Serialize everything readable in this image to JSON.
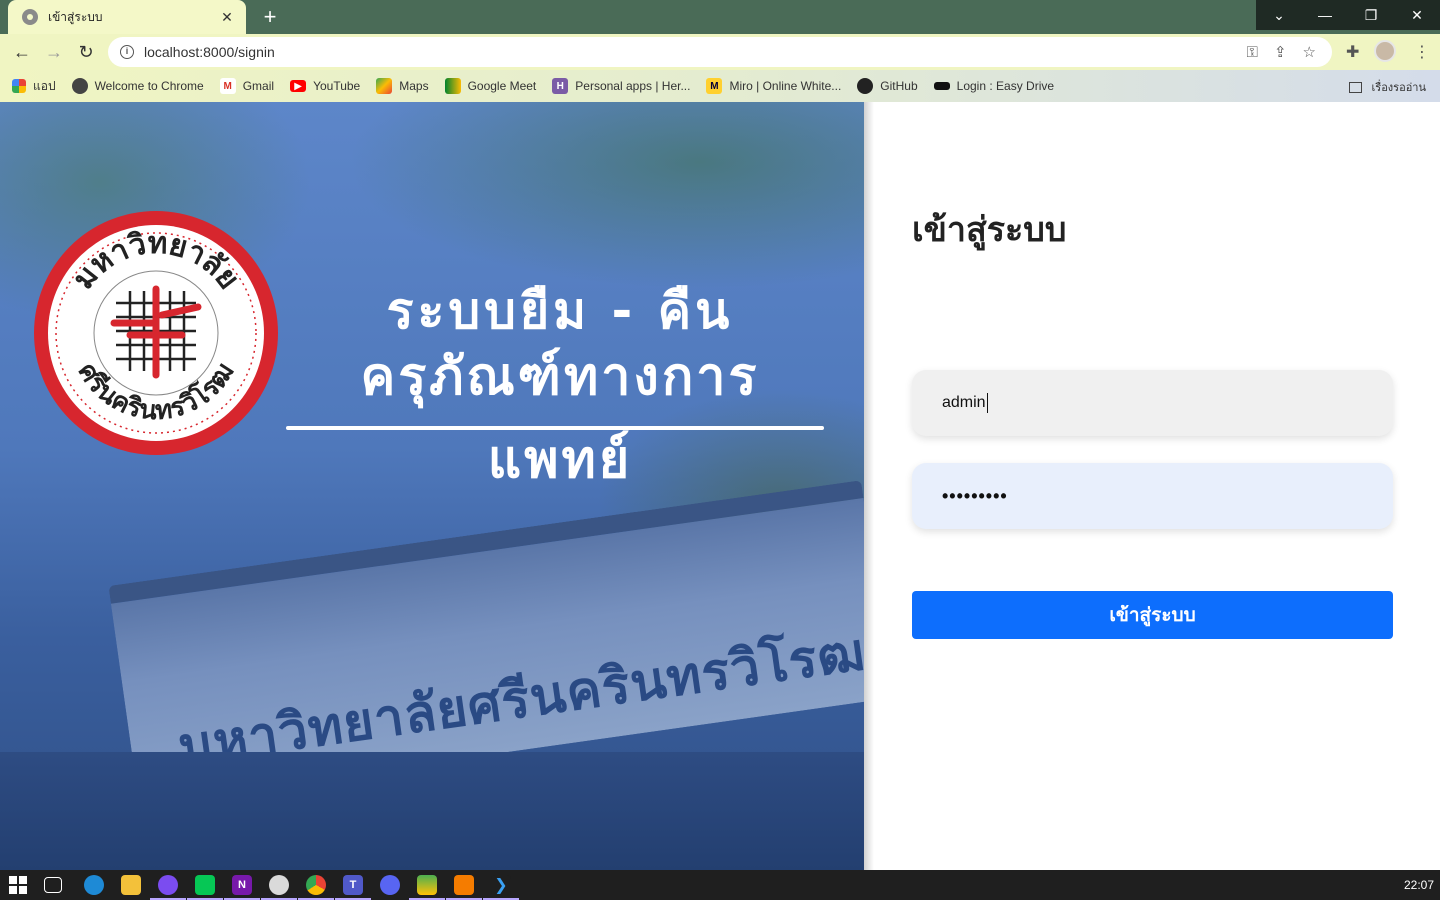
{
  "browser": {
    "tab_title": "เข้าสู่ระบบ",
    "tab_close": "✕",
    "new_tab": "+",
    "url": "localhost:8000/signin",
    "window_controls": [
      "⌄",
      "—",
      "❐",
      "✕"
    ],
    "bookmarks": [
      {
        "label": "แอป",
        "icon": "apps-grid-icon"
      },
      {
        "label": "Welcome to Chrome",
        "icon": "chrome-icon"
      },
      {
        "label": "Gmail",
        "icon": "gmail-icon"
      },
      {
        "label": "YouTube",
        "icon": "youtube-icon"
      },
      {
        "label": "Maps",
        "icon": "maps-icon"
      },
      {
        "label": "Google Meet",
        "icon": "meet-icon"
      },
      {
        "label": "Personal apps | Her...",
        "icon": "heroku-icon"
      },
      {
        "label": "Miro | Online White...",
        "icon": "miro-icon"
      },
      {
        "label": "GitHub",
        "icon": "github-icon"
      },
      {
        "label": "Login : Easy Drive",
        "icon": "easydrive-icon"
      }
    ],
    "reading_list": "เรื่องรออ่าน"
  },
  "hero": {
    "heading_line1": "ระบบยืม - คืน",
    "heading_line2": "ครุภัณฑ์ทางการแพทย์",
    "sign_text": "มหาวิทยาลัยศรีนครินทรวิโรฒ",
    "logo_top_text": "มหาวิทยาลัย",
    "logo_bottom_text": "ศรีนครินทรวิโรฒ",
    "logo_color": "#d7262e"
  },
  "login": {
    "title": "เข้าสู่ระบบ",
    "username_value": "admin",
    "password_mask": "•••••••••",
    "submit_label": "เข้าสู่ระบบ",
    "accent": "#0d6efd"
  },
  "taskbar": {
    "clock": "22:07"
  }
}
